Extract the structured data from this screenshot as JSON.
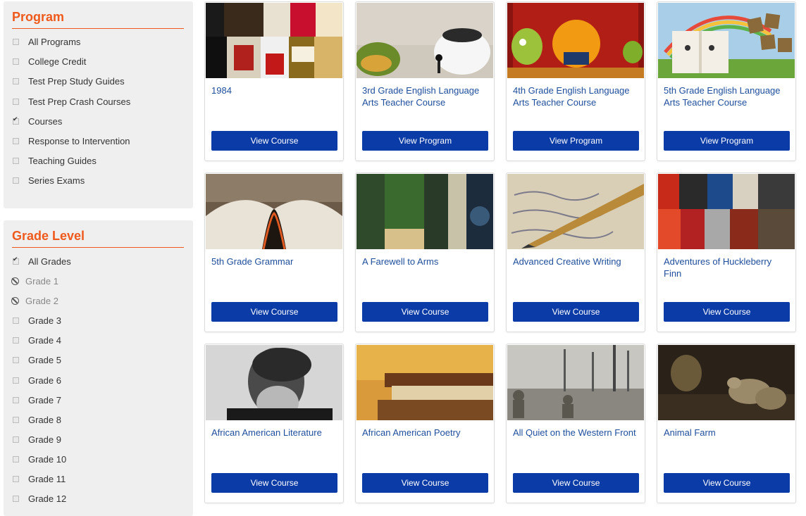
{
  "program_filter": {
    "title": "Program",
    "options": [
      {
        "label": "All Programs",
        "state": "unchecked"
      },
      {
        "label": "College Credit",
        "state": "unchecked"
      },
      {
        "label": "Test Prep Study Guides",
        "state": "unchecked"
      },
      {
        "label": "Test Prep Crash Courses",
        "state": "unchecked"
      },
      {
        "label": "Courses",
        "state": "checked"
      },
      {
        "label": "Response to Intervention",
        "state": "unchecked"
      },
      {
        "label": "Teaching Guides",
        "state": "unchecked"
      },
      {
        "label": "Series Exams",
        "state": "unchecked"
      }
    ]
  },
  "grade_filter": {
    "title": "Grade Level",
    "options": [
      {
        "label": "All Grades",
        "state": "checked"
      },
      {
        "label": "Grade 1",
        "state": "disabled"
      },
      {
        "label": "Grade 2",
        "state": "disabled"
      },
      {
        "label": "Grade 3",
        "state": "unchecked"
      },
      {
        "label": "Grade 4",
        "state": "unchecked"
      },
      {
        "label": "Grade 5",
        "state": "unchecked"
      },
      {
        "label": "Grade 6",
        "state": "unchecked"
      },
      {
        "label": "Grade 7",
        "state": "unchecked"
      },
      {
        "label": "Grade 8",
        "state": "unchecked"
      },
      {
        "label": "Grade 9",
        "state": "unchecked"
      },
      {
        "label": "Grade 10",
        "state": "unchecked"
      },
      {
        "label": "Grade 11",
        "state": "unchecked"
      },
      {
        "label": "Grade 12",
        "state": "unchecked"
      }
    ]
  },
  "courses": [
    {
      "title": "1984",
      "button": "View Course"
    },
    {
      "title": "3rd Grade English Language Arts Teacher Course",
      "button": "View Program"
    },
    {
      "title": "4th Grade English Language Arts Teacher Course",
      "button": "View Program"
    },
    {
      "title": "5th Grade English Language Arts Teacher Course",
      "button": "View Program"
    },
    {
      "title": "5th Grade Grammar",
      "button": "View Course"
    },
    {
      "title": "A Farewell to Arms",
      "button": "View Course"
    },
    {
      "title": "Advanced Creative Writing",
      "button": "View Course"
    },
    {
      "title": "Adventures of Huckleberry Finn",
      "button": "View Course"
    },
    {
      "title": "African American Literature",
      "button": "View Course"
    },
    {
      "title": "African American Poetry",
      "button": "View Course"
    },
    {
      "title": "All Quiet on the Western Front",
      "button": "View Course"
    },
    {
      "title": "Animal Farm",
      "button": "View Course"
    }
  ],
  "colors": {
    "accent": "#ef5a1c",
    "button": "#0a3ba6",
    "link": "#1f4e9c",
    "panel_bg": "#efefef"
  }
}
